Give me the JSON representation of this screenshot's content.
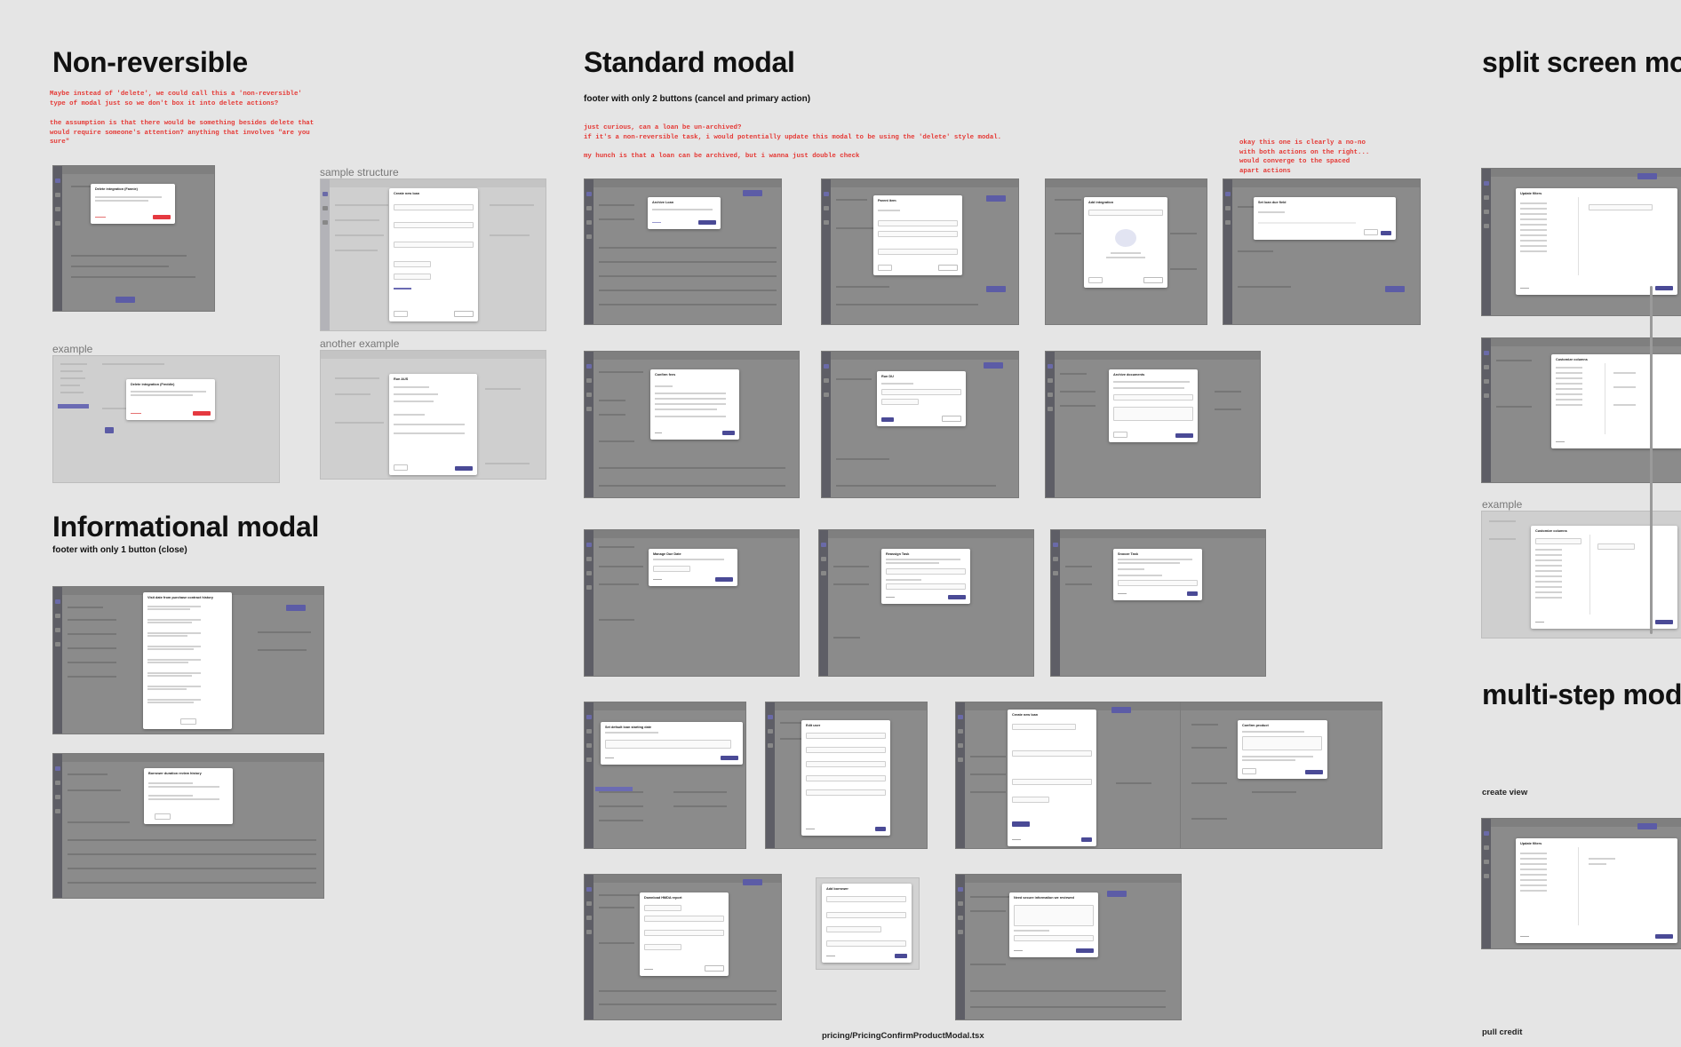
{
  "sections": {
    "non_reversible": {
      "title": "Non-reversible",
      "note_1": "Maybe instead of 'delete', we could call this a 'non-reversible'\ntype of modal just so we don't box it into delete actions?",
      "note_2": "the assumption is that there would be something besides delete that\nwould require someone's attention? anything that involves \"are you\nsure\""
    },
    "standard": {
      "title": "Standard modal",
      "subtitle": "footer with only 2 buttons (cancel and primary action)",
      "note_1": "just curious, can a loan be un-archived?\nif it's a non-reversible task, i would potentially update this modal to be using the 'delete' style modal.",
      "note_2": "my hunch is that a loan can be archived, but i wanna just double check",
      "note_3": "okay this one is clearly a no-no\nwith both actions on the right...\nwould converge to the spaced\napart actions",
      "file_caption": "pricing/PricingConfirmProductModal.tsx"
    },
    "informational": {
      "title": "Informational modal",
      "subtitle": "footer with only 1 button (close)"
    },
    "split": {
      "title": "split screen mo"
    },
    "multi": {
      "title": "multi-step mod",
      "caption_1": "create view",
      "caption_2": "pull credit"
    }
  },
  "labels": {
    "sample_structure": "sample structure",
    "example": "example",
    "another_example": "another example"
  },
  "modal_titles": {
    "delete_integration_1": "Delete integration (Fannie)",
    "delete_integration_2": "Delete integration (Freddie)",
    "create_new_loan": "Create new loan",
    "run_aus": "Run AUS",
    "visit_date": "Visit date from purchase contract history",
    "borrower_review": "Borrower duration review history",
    "archive_loan": "Archive Loan",
    "parent_item": "Parent item",
    "add_integration": "Add integration",
    "set_loan_due": "Set loan due field",
    "confirm_fees": "Confirm fees",
    "run_pull": "Run DU",
    "archive_documents": "Archive documents",
    "manage_due_date": "Manage Due Date",
    "reassign_task": "Reassign Task",
    "snooze_task": "Snooze Task",
    "set_default_start": "Set default loan starting date",
    "edit_user": "Edit user",
    "create_new_loan_2": "Create new loan",
    "confirm_product": "Confirm product",
    "download_hmda": "Download HMDA report",
    "add_borrower": "Add borrower",
    "need_secure_info": "Need secure information we reviewed",
    "update_filters": "Update filters",
    "customize_columns": "Customize columns",
    "customize_columns_2": "Customize columns",
    "update_filters_2": "Update filters"
  },
  "colors": {
    "canvas": "#e5e5e5",
    "note_red": "#e53935",
    "primary": "#4a4a96",
    "danger": "#e53940"
  }
}
